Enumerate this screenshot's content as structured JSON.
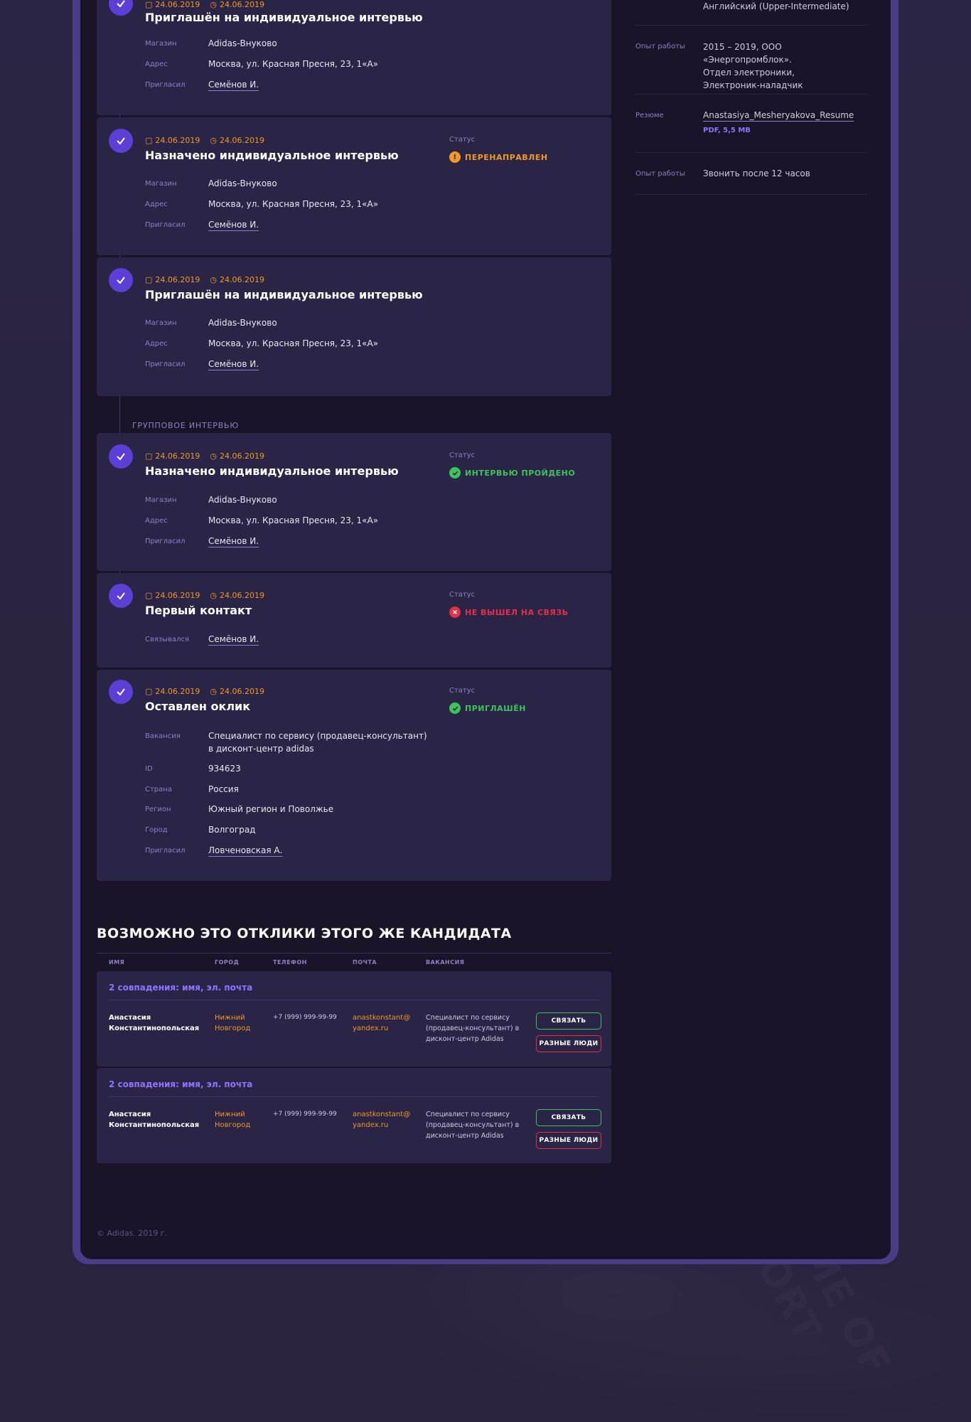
{
  "colors": {
    "accent": "#5b3fd6",
    "date": "#f39a1e",
    "success": "#3cc45b",
    "warning": "#f39a1e",
    "danger": "#e43046",
    "label": "#8a82c6"
  },
  "timeline": {
    "cards": [
      {
        "date": "24.06.2019",
        "time": "24.06.2019",
        "title": "Приглашён на индивидуальное интервью",
        "fields": [
          {
            "label": "Магазин",
            "value": "Adidas-Внуково"
          },
          {
            "label": "Адрес",
            "value": "Москва, ул. Красная Пресня, 23, 1«А»"
          },
          {
            "label": "Пригласил",
            "value": "Семёнов И."
          }
        ]
      },
      {
        "date": "24.06.2019",
        "time": "24.06.2019",
        "title": "Назначено индивидуальное интервью",
        "status_label": "Статус",
        "status": "ПЕРЕНАПРАВЛЕН",
        "status_icon": "warning-icon",
        "fields": [
          {
            "label": "Магазин",
            "value": "Adidas-Внуково"
          },
          {
            "label": "Адрес",
            "value": "Москва, ул. Красная Пресня, 23, 1«А»"
          },
          {
            "label": "Пригласил",
            "value": "Семёнов И."
          }
        ]
      },
      {
        "date": "24.06.2019",
        "time": "24.06.2019",
        "title": "Приглашён на индивидуальное интервью",
        "fields": [
          {
            "label": "Магазин",
            "value": "Adidas-Внуково"
          },
          {
            "label": "Адрес",
            "value": "Москва, ул. Красная Пресня, 23, 1«А»"
          },
          {
            "label": "Пригласил",
            "value": "Семёнов И."
          }
        ]
      },
      {
        "date": "24.06.2019",
        "time": "24.06.2019",
        "title": "Назначено индивидуальное интервью",
        "status_label": "Статус",
        "status": "ИНТЕРВЬЮ ПРОЙДЕНО",
        "status_icon": "check-circle-icon",
        "fields": [
          {
            "label": "Магазин",
            "value": "Adidas-Внуково"
          },
          {
            "label": "Адрес",
            "value": "Москва, ул. Красная Пресня, 23, 1«А»"
          },
          {
            "label": "Пригласил",
            "value": "Семёнов И."
          }
        ]
      },
      {
        "date": "24.06.2019",
        "time": "24.06.2019",
        "title": "Первый контакт",
        "status_label": "Статус",
        "status": "НЕ ВЫШЕЛ НА СВЯЗЬ",
        "status_icon": "x-circle-icon",
        "fields": [
          {
            "label": "Связывался",
            "value": "Семёнов И."
          }
        ]
      },
      {
        "date": "24.06.2019",
        "time": "24.06.2019",
        "title": "Оставлен оклик",
        "status_label": "Статус",
        "status": "ПРИГЛАШЁН",
        "status_icon": "check-circle-icon",
        "fields": [
          {
            "label": "Вакансия",
            "value": "Специалист по сервису (продавец-консультант)",
            "value2": "в дисконт-центр adidas"
          },
          {
            "label": "ID",
            "value": "934623"
          },
          {
            "label": "Страна",
            "value": "Россия"
          },
          {
            "label": "Регион",
            "value": "Южный регион и Поволжье"
          },
          {
            "label": "Город",
            "value": "Волгоград"
          },
          {
            "label": "Пригласил",
            "value": "Ловченовская А."
          }
        ]
      }
    ],
    "group_label": "ГРУППОВОЕ ИНТЕРВЬЮ"
  },
  "profile": {
    "language_value": "Английский (Upper-Intermediate)",
    "experience_label": "Опыт работы",
    "experience_value": [
      "2015 – 2019, ООО «Энергопромблок».",
      "Отдел электроники,",
      "Электроник-наладчик"
    ],
    "resume_label": "Резюме",
    "resume_file": "Anastasiya_Mesheryakova_Resume",
    "resume_meta": "PDF, 5,5 MB",
    "note_label": "Опыт работы",
    "note_value": "Звонить после 12 часов"
  },
  "duplicates": {
    "title": "ВОЗМОЖНО ЭТО ОТКЛИКИ ЭТОГО ЖЕ КАНДИДАТА",
    "columns": [
      "ИМЯ",
      "ГОРОД",
      "ТЕЛЕФОН",
      "ПОЧТА",
      "ВАКАНСИЯ"
    ],
    "rows": [
      {
        "match": "2 совпадения: имя, эл. почта",
        "name1": "Анастасия",
        "name2": "Константинопольская",
        "city1": "Нижний",
        "city2": "Новгород",
        "phone": "+7 (999) 999-99-99",
        "email1": "anastkonstant@",
        "email2": "yandex.ru",
        "vacancy1": "Специалист по сервису",
        "vacancy2": "(продавец-консультант) в",
        "vacancy3": "дисконт-центр Adidas",
        "btn_link": "СВЯЗАТЬ",
        "btn_diff": "РАЗНЫЕ ЛЮДИ"
      },
      {
        "match": "2 совпадения: имя, эл. почта",
        "name1": "Анастасия",
        "name2": "Константинопольская",
        "city1": "Нижний",
        "city2": "Новгород",
        "phone": "+7 (999) 999-99-99",
        "email1": "anastkonstant@",
        "email2": "yandex.ru",
        "vacancy1": "Специалист по сервису",
        "vacancy2": "(продавец-консультант) в",
        "vacancy3": "дисконт-центр Adidas",
        "btn_link": "СВЯЗАТЬ",
        "btn_diff": "РАЗНЫЕ ЛЮДИ"
      }
    ]
  },
  "footer": {
    "text": "© Adidas. 2019 г."
  },
  "background": {
    "deco_text": "HOME OF SPORT"
  }
}
